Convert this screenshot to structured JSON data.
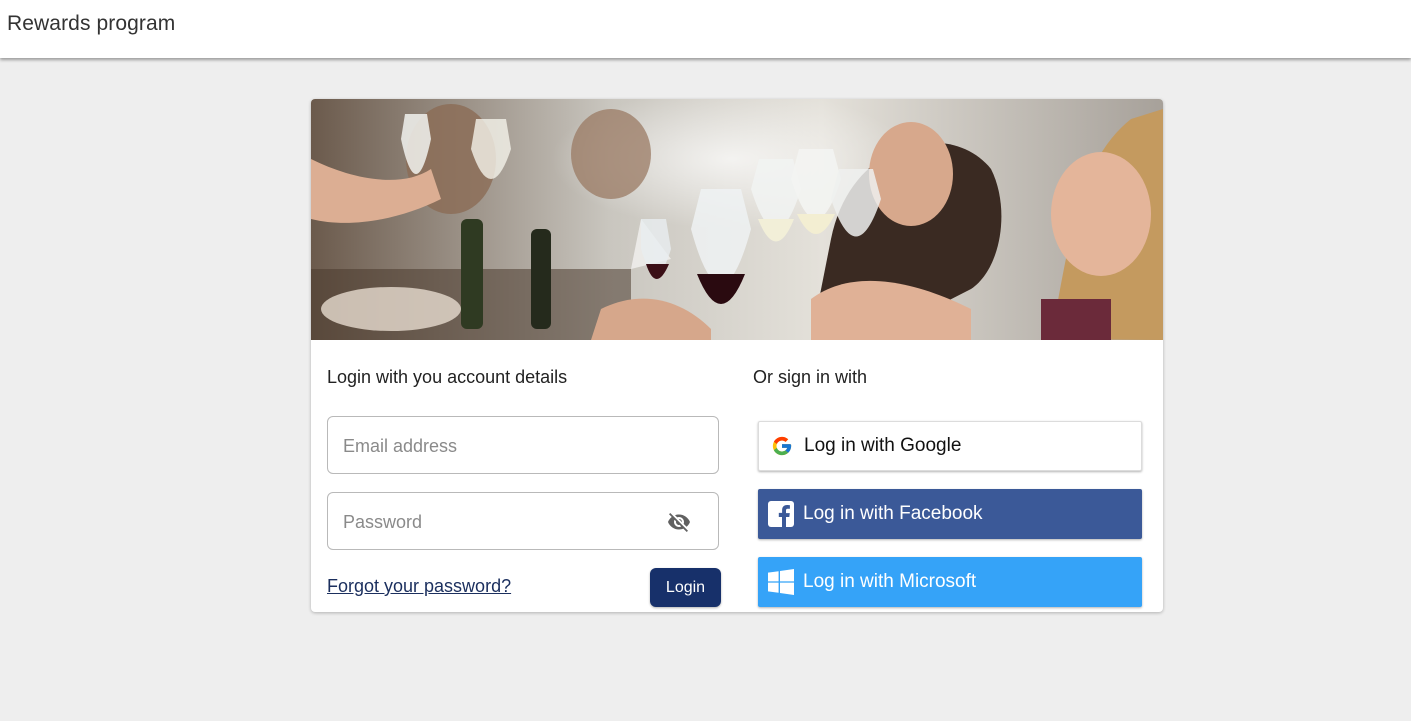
{
  "app_bar": {
    "title": "Rewards program"
  },
  "login": {
    "heading": "Login with you account details",
    "email_placeholder": "Email address",
    "password_placeholder": "Password",
    "forgot_password": "Forgot your password?",
    "login_button": "Login"
  },
  "social": {
    "heading": "Or sign in with",
    "google": "Log in with Google",
    "facebook": "Log in with Facebook",
    "microsoft": "Log in with Microsoft"
  },
  "icons": {
    "password_toggle": "eye-off-icon",
    "google": "google-icon",
    "facebook": "facebook-icon",
    "microsoft": "windows-icon"
  },
  "colors": {
    "app_background": "#eeeeee",
    "login_button": "#17306a",
    "link": "#1b2f5e",
    "facebook": "#3b5998",
    "microsoft": "#35a3f8"
  }
}
